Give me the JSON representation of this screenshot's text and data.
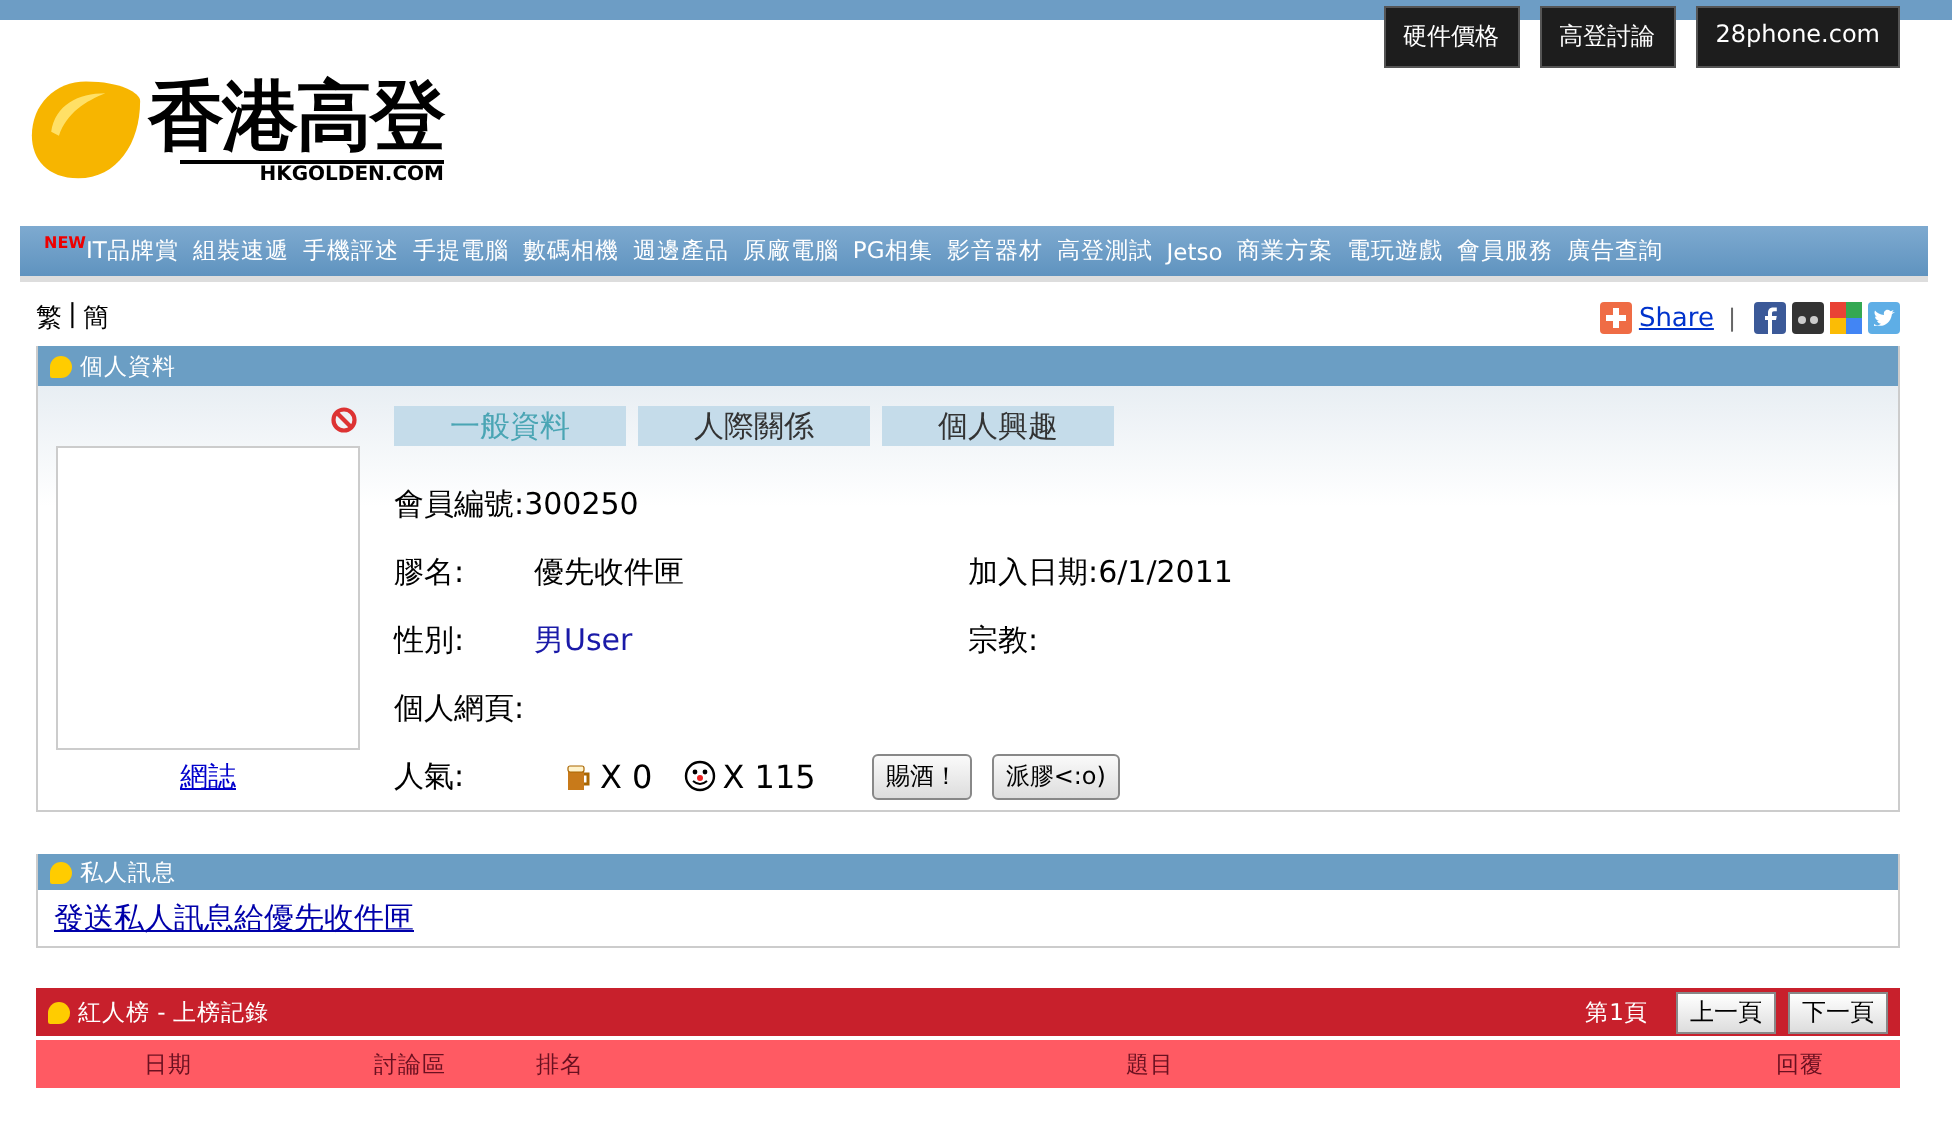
{
  "top_links": [
    "硬件價格",
    "高登討論",
    "28phone.com"
  ],
  "logo": {
    "title": "香港高登",
    "subtitle": "HKGOLDEN.COM"
  },
  "nav": {
    "badge": "NEW",
    "items": [
      "IT品牌賞",
      "組裝速遞",
      "手機評述",
      "手提電腦",
      "數碼相機",
      "週邊產品",
      "原廠電腦",
      "PG相集",
      "影音器材",
      "高登測試",
      "Jetso",
      "商業方案",
      "電玩遊戲",
      "會員服務",
      "廣告查詢"
    ]
  },
  "language": {
    "options": [
      "繁",
      "簡"
    ],
    "separator": "|"
  },
  "share": {
    "label": "Share",
    "separator": "|"
  },
  "profile": {
    "title": "個人資料",
    "blog_link": "網誌",
    "tabs": [
      {
        "label": "一般資料",
        "selected": true
      },
      {
        "label": "人際關係",
        "selected": false
      },
      {
        "label": "個人興趣",
        "selected": false
      }
    ],
    "rows": [
      [
        {
          "label": "會員編號:",
          "value": "300250",
          "kind": "inline"
        }
      ],
      [
        {
          "label": "膠名:",
          "value": "優先收件匣",
          "kind": "column"
        },
        {
          "label": "加入日期:",
          "value": "6/1/2011",
          "kind": "inline"
        }
      ],
      [
        {
          "label": "性別:",
          "value": "男User",
          "kind": "highlight"
        },
        {
          "label": "宗教:",
          "kind": "inline"
        }
      ],
      [
        {
          "label": "個人網頁:",
          "kind": "inline"
        }
      ]
    ],
    "popularity": {
      "label": "人氣:",
      "counts": [
        {
          "kind": "beer",
          "text": "X 0"
        },
        {
          "kind": "smiley",
          "text": "X 115"
        }
      ],
      "buttons": [
        "賜酒！",
        "派膠<:o)"
      ]
    }
  },
  "messages": {
    "title": "私人訊息",
    "link": "發送私人訊息給優先收件匣"
  },
  "ranking": {
    "title": "紅人榜 - 上榜記錄",
    "page": "第1頁",
    "buttons": [
      "上一頁",
      "下一頁"
    ],
    "columns": [
      "日期",
      "討論區",
      "排名",
      "題目",
      "回覆"
    ]
  }
}
